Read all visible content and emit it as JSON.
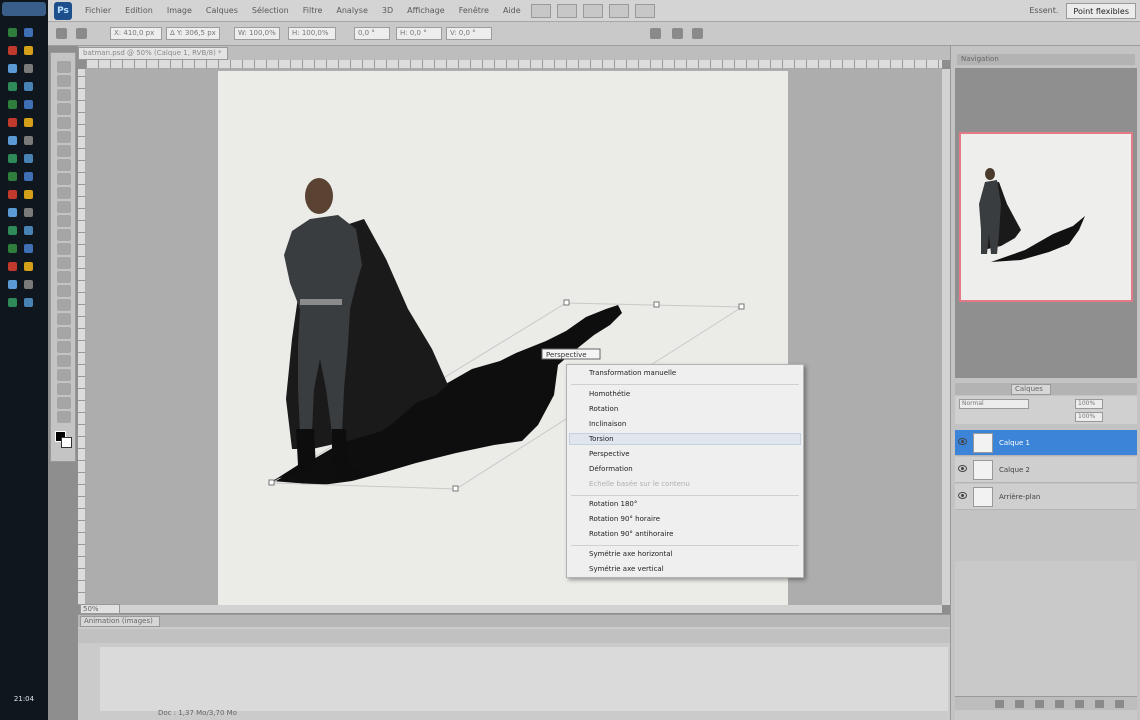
{
  "app": {
    "menu": [
      "Fichier",
      "Edition",
      "Image",
      "Calques",
      "Sélection",
      "Filtre",
      "Analyse",
      "3D",
      "Affichage",
      "Fenêtre",
      "Aide"
    ],
    "workspace_label": "Essent.",
    "workspace_button": "Point flexibles",
    "logo": "Ps"
  },
  "options_bar": {
    "fields": [
      "X: 410,0 px",
      "Δ Y: 306,5 px",
      "W: 100,0%",
      "H: 100,0%",
      "0,0 °",
      "H: 0,0 °",
      "V: 0,0 °"
    ]
  },
  "document": {
    "tab_title": "batman.psd @ 50% (Calque 1, RVB/8) *",
    "zoom": "50%",
    "transform_tooltip": "Perspective"
  },
  "context_menu": {
    "header": "Transformation manuelle",
    "groups": [
      [
        "Homothétie",
        "Rotation",
        "Inclinaison",
        "Torsion",
        "Perspective",
        "Déformation",
        "Echelle basée sur le contenu"
      ],
      [
        "Rotation 180°",
        "Rotation 90° horaire",
        "Rotation 90° antihoraire"
      ],
      [
        "Symétrie axe horizontal",
        "Symétrie axe vertical"
      ]
    ],
    "disabled": [
      "Echelle basée sur le contenu"
    ],
    "hovered": "Torsion"
  },
  "navigator": {
    "title": "Navigation"
  },
  "layers_panel": {
    "tab": "Calques",
    "blend_mode": "Normal",
    "opacity": "100%",
    "fill": "100%",
    "layers": [
      {
        "name": "Calque 1",
        "selected": true
      },
      {
        "name": "Calque 2",
        "selected": false
      },
      {
        "name": "Arrière-plan",
        "selected": false
      }
    ]
  },
  "bottom_panel": {
    "tab": "Animation (images)",
    "status": "Doc : 1,37 Mo/3,70 Mo"
  },
  "taskbar": {
    "clock": "21:04"
  },
  "colors": {
    "selection_blue": "#3b84d8",
    "navigator_frame": "#e47a88"
  }
}
